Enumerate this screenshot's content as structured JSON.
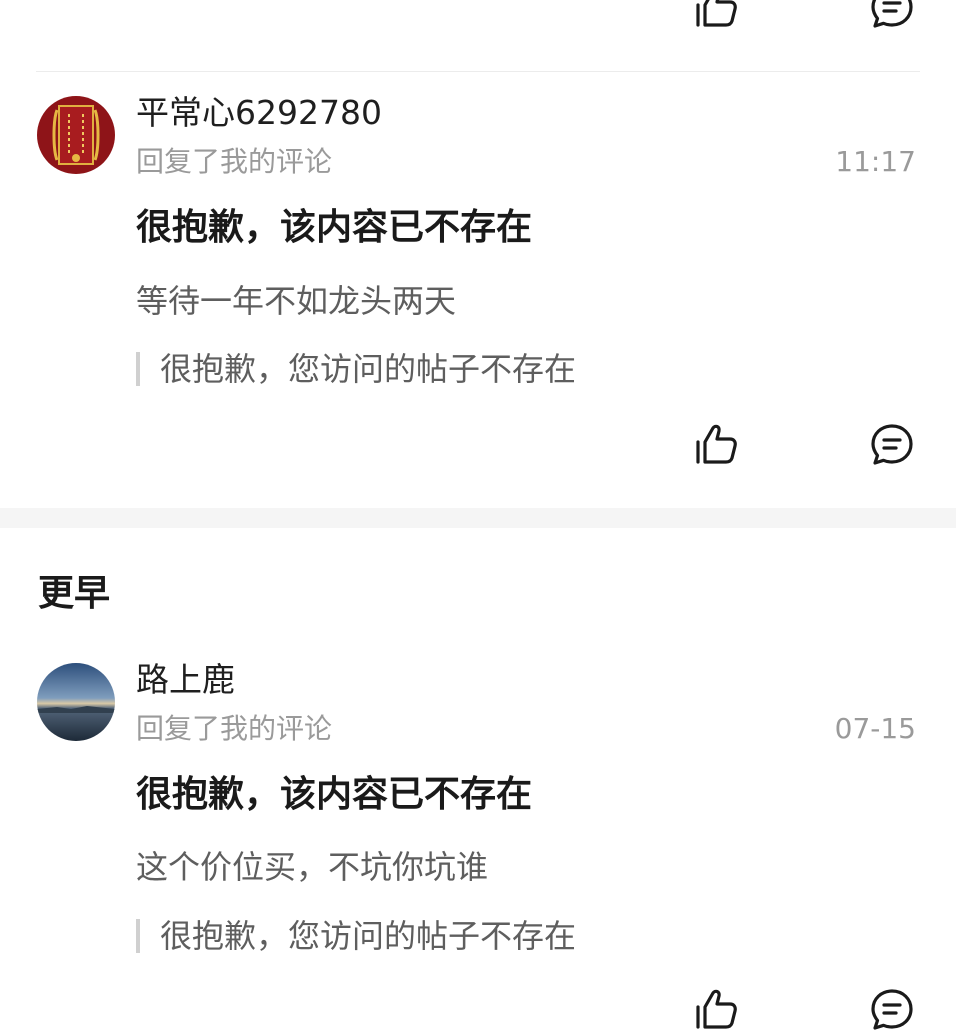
{
  "top_partial": {
    "like_icon": "thumbs-up-icon",
    "comment_icon": "comment-icon"
  },
  "notifications": [
    {
      "username": "平常心6292780",
      "action": "回复了我的评论",
      "time": "11:17",
      "title": "很抱歉，该内容已不存在",
      "reply": "等待一年不如龙头两天",
      "quote": "很抱歉，您访问的帖子不存在"
    },
    {
      "username": "路上鹿",
      "action": "回复了我的评论",
      "time": "07-15",
      "title": "很抱歉，该内容已不存在",
      "reply": "这个价位买，不坑你坑谁",
      "quote": "很抱歉，您访问的帖子不存在"
    }
  ],
  "section": {
    "earlier_label": "更早"
  },
  "colors": {
    "text_primary": "#1a1a1a",
    "text_secondary": "#9a9a9a",
    "text_reply": "#5e5e5e",
    "divider": "#ececec"
  }
}
